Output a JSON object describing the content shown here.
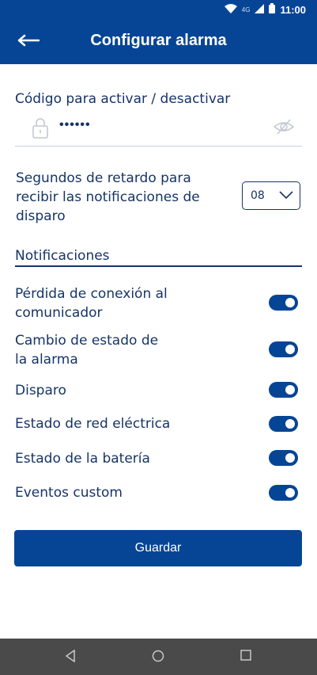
{
  "status_bar": {
    "time": "11:00",
    "network": "4G"
  },
  "app_bar": {
    "title": "Configurar alarma"
  },
  "code": {
    "label": "Código para activar / desactivar",
    "value": "••••••"
  },
  "delay": {
    "label": "Segundos de retardo para recibir las notificaciones de disparo",
    "selected": "08"
  },
  "notifications": {
    "heading": "Notificaciones",
    "items": [
      {
        "label": "Pérdida de conexión al comunicador",
        "enabled": true
      },
      {
        "label": "Cambio de estado de la alarma",
        "enabled": true
      },
      {
        "label": "Disparo",
        "enabled": true
      },
      {
        "label": "Estado de red eléctrica",
        "enabled": true
      },
      {
        "label": "Estado de la batería",
        "enabled": true
      },
      {
        "label": "Eventos custom",
        "enabled": true
      }
    ]
  },
  "save_label": "Guardar",
  "colors": {
    "primary": "#064596",
    "text": "#163468"
  }
}
